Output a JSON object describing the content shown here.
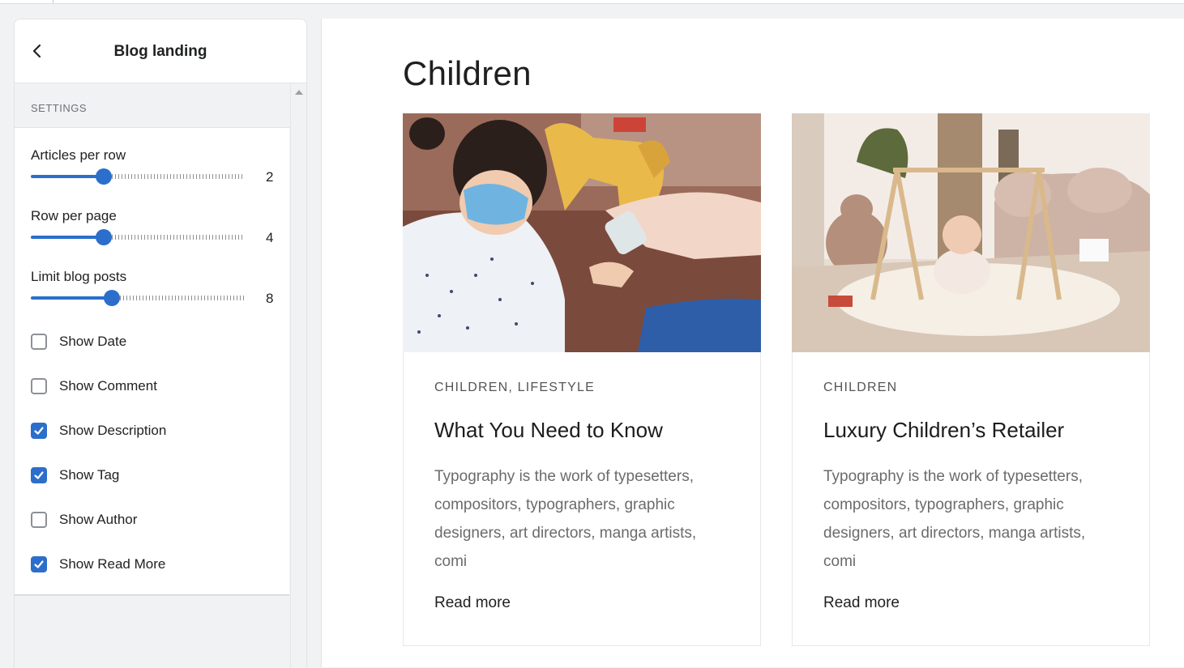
{
  "panel": {
    "title": "Blog landing",
    "section_label": "SETTINGS",
    "ranges": [
      {
        "label": "Articles per row",
        "value": "2",
        "fraction": 0.34
      },
      {
        "label": "Row per page",
        "value": "4",
        "fraction": 0.34
      },
      {
        "label": "Limit blog posts",
        "value": "8",
        "fraction": 0.38
      }
    ],
    "checkboxes": [
      {
        "label": "Show Date",
        "checked": false
      },
      {
        "label": "Show Comment",
        "checked": false
      },
      {
        "label": "Show Description",
        "checked": true
      },
      {
        "label": "Show Tag",
        "checked": true
      },
      {
        "label": "Show Author",
        "checked": false
      },
      {
        "label": "Show Read More",
        "checked": true
      }
    ]
  },
  "preview": {
    "title": "Children",
    "cards": [
      {
        "categories": "CHILDREN,  LIFESTYLE",
        "title": "What You Need to Know",
        "description": "Typography is the work of typesetters, compositors, typographers, graphic designers, art directors, manga artists, comi",
        "read_more": "Read more"
      },
      {
        "categories": "CHILDREN",
        "title": "Luxury Children’s Retailer",
        "description": "Typography is the work of typesetters, compositors, typographers, graphic designers, art directors, manga artists, comi",
        "read_more": "Read more"
      }
    ]
  },
  "colors": {
    "accent": "#2c6ecb",
    "text": "#202223"
  }
}
